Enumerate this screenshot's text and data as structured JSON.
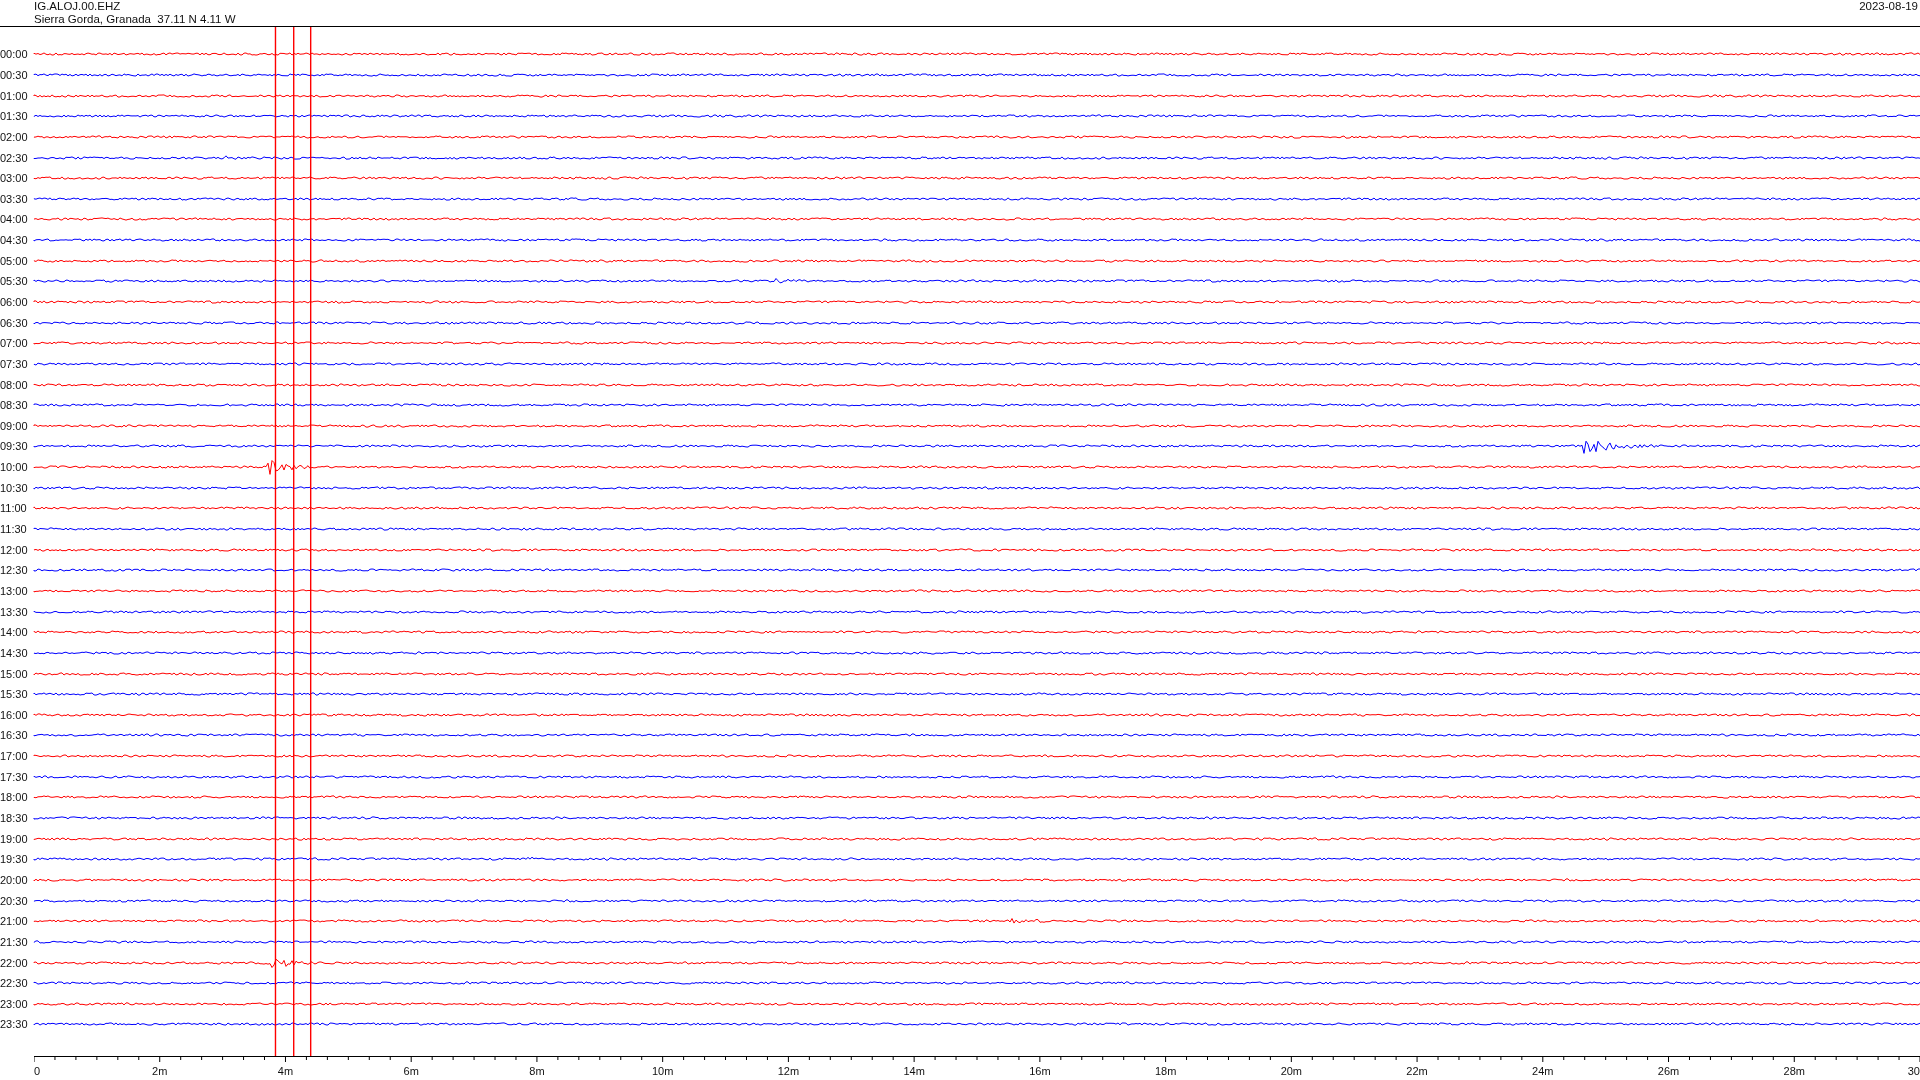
{
  "header": {
    "station": "IG.ALOJ.00.EHZ",
    "location": "Sierra Gorda, Granada  37.11 N 4.11 W",
    "date": "2023-08-19"
  },
  "rows": [
    {
      "time": "00:00",
      "color": "#ff0000"
    },
    {
      "time": "00:30",
      "color": "#0000ff"
    },
    {
      "time": "01:00",
      "color": "#ff0000"
    },
    {
      "time": "01:30",
      "color": "#0000ff"
    },
    {
      "time": "02:00",
      "color": "#ff0000"
    },
    {
      "time": "02:30",
      "color": "#0000ff"
    },
    {
      "time": "03:00",
      "color": "#ff0000"
    },
    {
      "time": "03:30",
      "color": "#0000ff"
    },
    {
      "time": "04:00",
      "color": "#ff0000"
    },
    {
      "time": "04:30",
      "color": "#0000ff"
    },
    {
      "time": "05:00",
      "color": "#ff0000"
    },
    {
      "time": "05:30",
      "color": "#0000ff"
    },
    {
      "time": "06:00",
      "color": "#ff0000"
    },
    {
      "time": "06:30",
      "color": "#0000ff"
    },
    {
      "time": "07:00",
      "color": "#ff0000"
    },
    {
      "time": "07:30",
      "color": "#0000ff"
    },
    {
      "time": "08:00",
      "color": "#ff0000"
    },
    {
      "time": "08:30",
      "color": "#0000ff"
    },
    {
      "time": "09:00",
      "color": "#ff0000"
    },
    {
      "time": "09:30",
      "color": "#0000ff"
    },
    {
      "time": "10:00",
      "color": "#ff0000"
    },
    {
      "time": "10:30",
      "color": "#0000ff"
    },
    {
      "time": "11:00",
      "color": "#ff0000"
    },
    {
      "time": "11:30",
      "color": "#0000ff"
    },
    {
      "time": "12:00",
      "color": "#ff0000"
    },
    {
      "time": "12:30",
      "color": "#0000ff"
    },
    {
      "time": "13:00",
      "color": "#ff0000"
    },
    {
      "time": "13:30",
      "color": "#0000ff"
    },
    {
      "time": "14:00",
      "color": "#ff0000"
    },
    {
      "time": "14:30",
      "color": "#0000ff"
    },
    {
      "time": "15:00",
      "color": "#ff0000"
    },
    {
      "time": "15:30",
      "color": "#0000ff"
    },
    {
      "time": "16:00",
      "color": "#ff0000"
    },
    {
      "time": "16:30",
      "color": "#0000ff"
    },
    {
      "time": "17:00",
      "color": "#ff0000"
    },
    {
      "time": "17:30",
      "color": "#0000ff"
    },
    {
      "time": "18:00",
      "color": "#ff0000"
    },
    {
      "time": "18:30",
      "color": "#0000ff"
    },
    {
      "time": "19:00",
      "color": "#ff0000"
    },
    {
      "time": "19:30",
      "color": "#0000ff"
    },
    {
      "time": "20:00",
      "color": "#ff0000"
    },
    {
      "time": "20:30",
      "color": "#0000ff"
    },
    {
      "time": "21:00",
      "color": "#ff0000"
    },
    {
      "time": "21:30",
      "color": "#0000ff"
    },
    {
      "time": "22:00",
      "color": "#ff0000"
    },
    {
      "time": "22:30",
      "color": "#0000ff"
    },
    {
      "time": "23:00",
      "color": "#ff0000"
    },
    {
      "time": "23:30",
      "color": "#0000ff"
    }
  ],
  "x_axis": [
    "0",
    "2m",
    "4m",
    "6m",
    "8m",
    "10m",
    "12m",
    "14m",
    "16m",
    "18m",
    "20m",
    "22m",
    "24m",
    "26m",
    "28m",
    "30"
  ]
}
